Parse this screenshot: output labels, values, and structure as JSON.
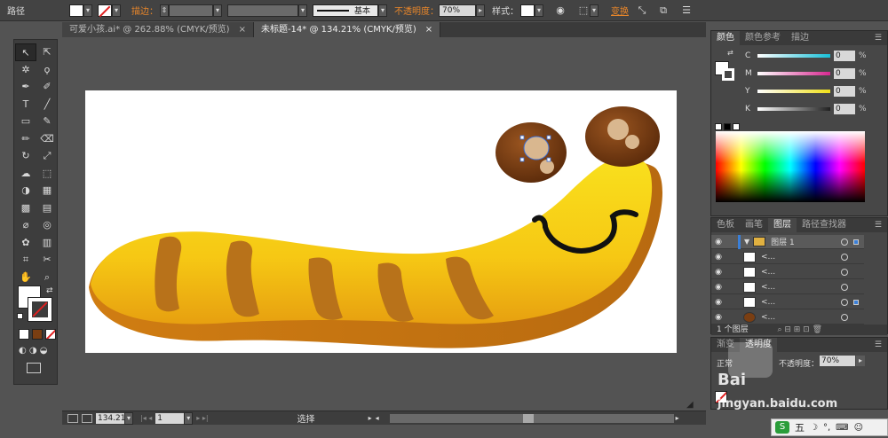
{
  "control_bar": {
    "path_label": "路径",
    "stroke_label": "描边：",
    "stroke_style": "基本",
    "opacity_label": "不透明度：",
    "opacity_value": "70%",
    "style_label": "样式：",
    "transform_label": "变换"
  },
  "tabs": [
    {
      "title": "可爱小孩.ai* @ 262.88% (CMYK/预览)",
      "close": "×"
    },
    {
      "title": "未标题-14* @ 134.21% (CMYK/预览)",
      "close": "×"
    }
  ],
  "status": {
    "zoom": "134.21",
    "page": "1",
    "selection_tool": "选择"
  },
  "color_panel": {
    "tabs": [
      "颜色",
      "颜色参考",
      "描边"
    ],
    "sliders": [
      {
        "key": "C",
        "value": "0",
        "unit": "%",
        "color": "#18c0d8"
      },
      {
        "key": "M",
        "value": "0",
        "unit": "%",
        "color": "#d82890"
      },
      {
        "key": "Y",
        "value": "0",
        "unit": "%",
        "color": "#f0e018"
      },
      {
        "key": "K",
        "value": "0",
        "unit": "%",
        "color": "#202020"
      }
    ]
  },
  "layers_panel": {
    "tabs": [
      "色板",
      "画笔",
      "图层",
      "路径查找器"
    ],
    "layer_name": "图层 1",
    "items": [
      "<...",
      "<...",
      "<...",
      "<...",
      "<..."
    ],
    "footer": "1 个图层"
  },
  "transparency_panel": {
    "tabs": [
      "渐变",
      "透明度"
    ],
    "mode": "正常",
    "opacity_label": "不透明度：",
    "opacity_value": "70%"
  },
  "watermark": {
    "brand": "Bai",
    "domain": "jingyan.baidu.com",
    "ime_label": "五"
  },
  "colors": {
    "worm_yellow": "#f7d117",
    "worm_orange": "#e39a12",
    "stripe": "#b8721a",
    "eye_brown": "#7a3e12",
    "accent_orange": "#e8862a"
  }
}
